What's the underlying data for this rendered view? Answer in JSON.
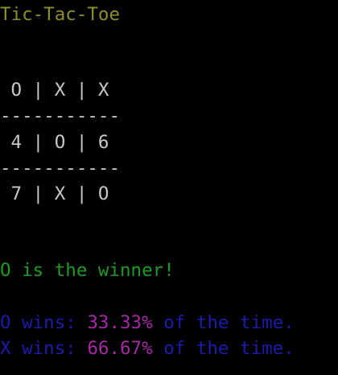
{
  "title": "Tic-Tac-Toe",
  "board": {
    "rows": [
      " O | X | X",
      " 4 | O | 6",
      " 7 | X | O"
    ],
    "separator": "-----------"
  },
  "result": {
    "winner_text": "O is the winner!"
  },
  "stats": {
    "o": {
      "prefix": "O wins: ",
      "percent": "33.33%",
      "suffix": " of the time."
    },
    "x": {
      "prefix": "X wins: ",
      "percent": "66.67%",
      "suffix": " of the time."
    }
  },
  "colors": {
    "title": "#8e8e2c",
    "board": "#c8c8c8",
    "winner": "#1f9a24",
    "stats_text": "#1c1ca8",
    "stats_percent": "#a52aa5",
    "background": "#000000"
  }
}
